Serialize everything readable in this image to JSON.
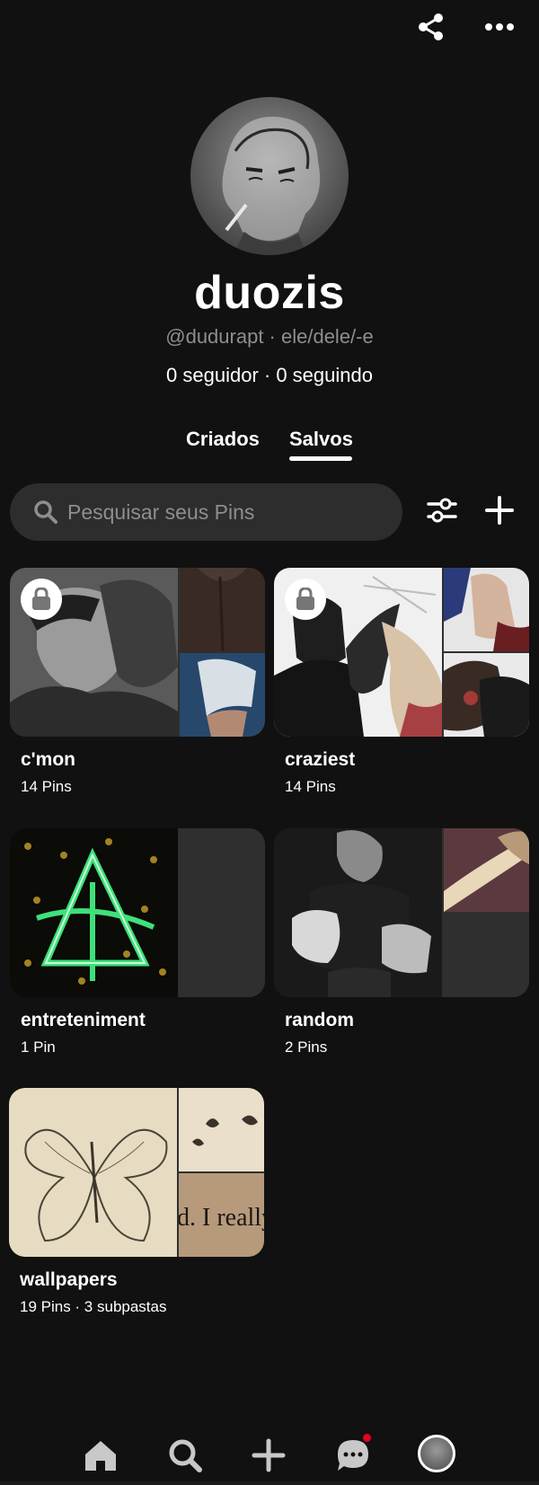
{
  "top_actions": {
    "share_icon": "share-icon",
    "more_icon": "more-icon"
  },
  "profile": {
    "name": "duozis",
    "handle": "@dudurapt · ele/dele/-e",
    "followers": "0 seguidor · 0 seguindo"
  },
  "tabs": [
    {
      "label": "Criados",
      "active": false
    },
    {
      "label": "Salvos",
      "active": true
    }
  ],
  "search": {
    "placeholder": "Pesquisar seus Pins"
  },
  "boards": [
    {
      "title": "c'mon",
      "count": "14 Pins",
      "locked": true
    },
    {
      "title": "craziest",
      "count": "14 Pins",
      "locked": true
    },
    {
      "title": "entreteniment",
      "count": "1 Pin",
      "locked": false
    },
    {
      "title": "random",
      "count": "2 Pins",
      "locked": false
    },
    {
      "title": "wallpapers",
      "count": "19 Pins · 3 subpastas",
      "locked": false
    }
  ],
  "nav": {
    "items": [
      "home-icon",
      "search-icon",
      "plus-icon",
      "chat-icon",
      "profile-avatar"
    ],
    "notification_color": "#e60023"
  },
  "colors": {
    "background": "#111111",
    "surface": "#2d2d2d",
    "muted_text": "#8e8e8e",
    "accent": "#e60023"
  }
}
